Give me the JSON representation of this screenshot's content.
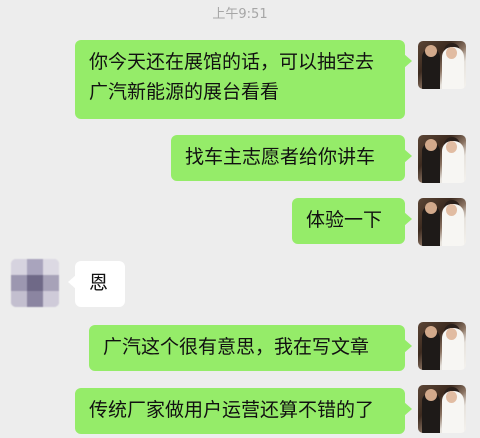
{
  "chat": {
    "timestamp": "上午9:51",
    "messages": [
      {
        "side": "out",
        "lines": [
          "你今天还在展馆的话，可以抽空去",
          "广汽新能源的展台看看"
        ]
      },
      {
        "side": "out",
        "lines": [
          "找车主志愿者给你讲车"
        ]
      },
      {
        "side": "out",
        "lines": [
          "体验一下"
        ]
      },
      {
        "side": "in",
        "lines": [
          "恩"
        ]
      },
      {
        "side": "out",
        "lines": [
          "广汽这个很有意思，我在写文章"
        ]
      },
      {
        "side": "out",
        "lines": [
          "传统厂家做用户运营还算不错的了"
        ]
      }
    ]
  }
}
